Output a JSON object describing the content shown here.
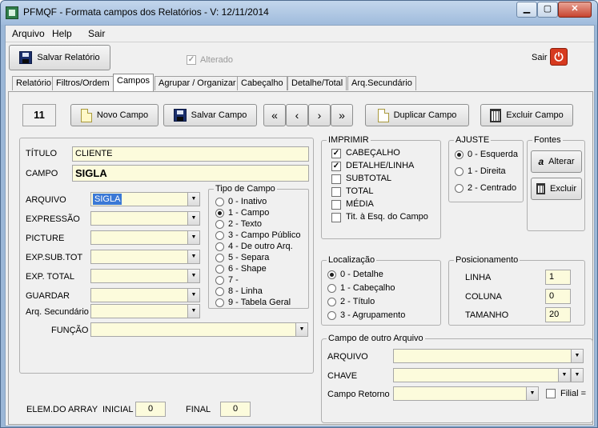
{
  "window": {
    "title": "PFMQF - Formata campos dos Relatórios - V: 12/11/2014",
    "min_icon": "minimize-icon",
    "max_icon": "maximize-icon",
    "close_icon": "close-icon"
  },
  "menu": {
    "arquivo": "Arquivo",
    "help": "Help",
    "sair": "Sair"
  },
  "toolbar": {
    "save_report": "Salvar Relatório",
    "altered": "Alterado",
    "altered_checked": true,
    "exit": "Sair"
  },
  "tabs": [
    "Relatório",
    "Filtros/Ordem",
    "Campos",
    "Agrupar / Organizar",
    "Cabeçalho",
    "Detalhe/Total",
    "Arq.Secundário"
  ],
  "active_tab": "Campos",
  "nav": {
    "count": "11",
    "new_field": "Novo Campo",
    "save_field": "Salvar Campo",
    "duplicate": "Duplicar Campo",
    "delete": "Excluir Campo"
  },
  "form": {
    "titulo_label": "TÍTULO",
    "titulo_value": "CLIENTE",
    "campo_label": "CAMPO",
    "campo_value": "SIGLA",
    "arquivo_label": "ARQUIVO",
    "arquivo_value": "SIGLA",
    "expressao_label": "EXPRESSÃO",
    "picture_label": "PICTURE",
    "expsubtot_label": "EXP.SUB.TOT",
    "exptotal_label": "EXP. TOTAL",
    "guardar_label": "GUARDAR",
    "arqsec_label": "Arq. Secundário",
    "funcao_label": "FUNÇÃO"
  },
  "tipo_campo": {
    "title": "Tipo de Campo",
    "options": [
      "0 - Inativo",
      "1 - Campo",
      "2 - Texto",
      "3 - Campo Público",
      "4 - De outro Arq.",
      "5 - Separa",
      "6 - Shape",
      "7 -",
      "8 - Linha",
      "9 - Tabela Geral"
    ],
    "selected": 1
  },
  "imprimir": {
    "title": "IMPRIMIR",
    "options": [
      {
        "label": "CABEÇALHO",
        "checked": true
      },
      {
        "label": "DETALHE/LINHA",
        "checked": true
      },
      {
        "label": "SUBTOTAL",
        "checked": false
      },
      {
        "label": "TOTAL",
        "checked": false
      },
      {
        "label": "MÉDIA",
        "checked": false
      },
      {
        "label": "Tit. à Esq. do Campo",
        "checked": false
      }
    ]
  },
  "ajuste": {
    "title": "AJUSTE",
    "options": [
      "0 - Esquerda",
      "1 - Direita",
      "2 - Centrado"
    ],
    "selected": 0
  },
  "fontes": {
    "title": "Fontes",
    "alterar": "Alterar",
    "excluir": "Excluir"
  },
  "localizacao": {
    "title": "Localização",
    "options": [
      "0 - Detalhe",
      "1 - Cabeçalho",
      "2 - Título",
      "3 - Agrupamento"
    ],
    "selected": 0
  },
  "posicionamento": {
    "title": "Posicionamento",
    "linha_label": "LINHA",
    "linha": "1",
    "coluna_label": "COLUNA",
    "coluna": "0",
    "tamanho_label": "TAMANHO",
    "tamanho": "20"
  },
  "outro_arquivo": {
    "title": "Campo de outro Arquivo",
    "arquivo_label": "ARQUIVO",
    "chave_label": "CHAVE",
    "retorno_label": "Campo Retorno",
    "filial_label": "Filial ="
  },
  "array": {
    "label": "ELEM.DO ARRAY",
    "inicial_label": "INICIAL",
    "inicial": "0",
    "final_label": "FINAL",
    "final": "0"
  }
}
